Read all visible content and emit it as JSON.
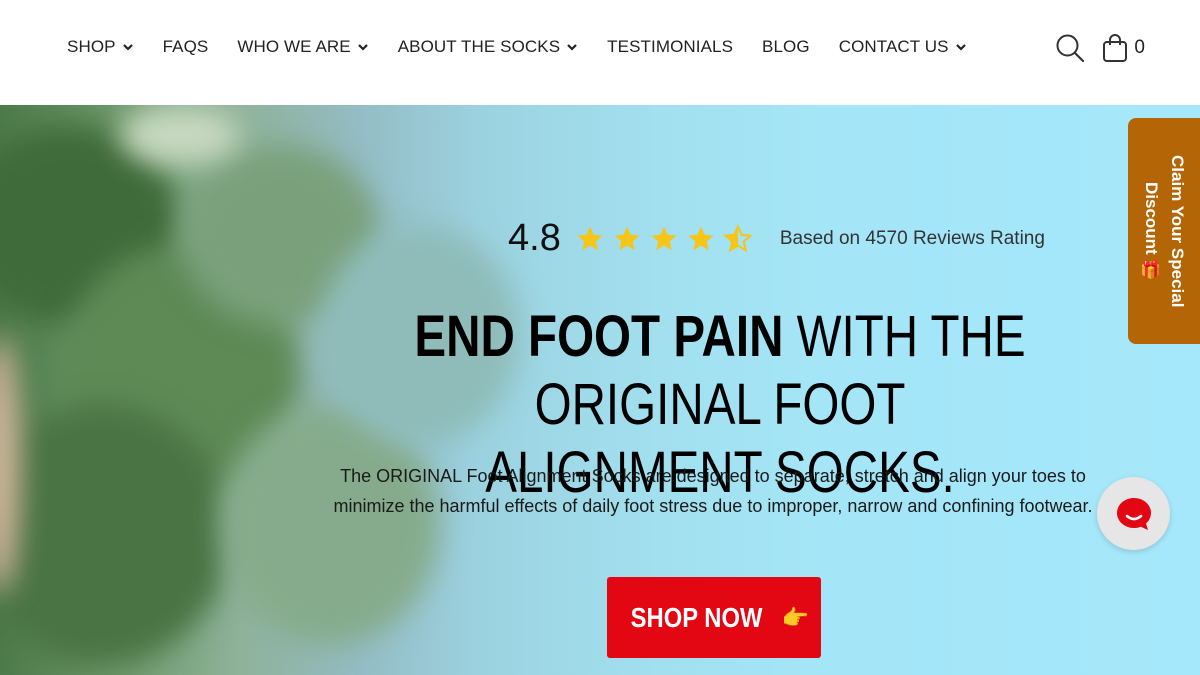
{
  "nav": {
    "items": [
      {
        "label": "SHOP",
        "has_dropdown": true
      },
      {
        "label": "FAQS",
        "has_dropdown": false
      },
      {
        "label": "WHO WE ARE",
        "has_dropdown": true
      },
      {
        "label": "ABOUT THE SOCKS",
        "has_dropdown": true
      },
      {
        "label": "TESTIMONIALS",
        "has_dropdown": false
      },
      {
        "label": "BLOG",
        "has_dropdown": false
      },
      {
        "label": "CONTACT US",
        "has_dropdown": true
      }
    ]
  },
  "header": {
    "search_icon": "search-icon",
    "cart_icon": "shopping-bag-icon",
    "cart_count": "0"
  },
  "hero": {
    "rating": {
      "score": "4.8",
      "stars_value": 4.5,
      "stars_max": 5,
      "text": "Based on 4570  Reviews Rating",
      "star_color": "#f5c518"
    },
    "headline": {
      "bold": "END FOOT PAIN",
      "line1_rest": " WITH THE",
      "line2": "ORIGINAL FOOT ALIGNMENT SOCKS."
    },
    "subtext": "The ORIGINAL Foot Alignment Socks are designed to separate, stretch and align your toes to minimize the harmful effects of daily foot stress due to improper, narrow and confining footwear.",
    "cta": {
      "label": "SHOP NOW",
      "icon": "pointing-hand-icon",
      "color": "#e30613"
    }
  },
  "discount_tab": {
    "label": "Claim Your Special Discount",
    "icon": "gift-icon",
    "color": "#b46505"
  },
  "chat": {
    "icon": "chat-bubble-icon",
    "color": "#e30613"
  }
}
